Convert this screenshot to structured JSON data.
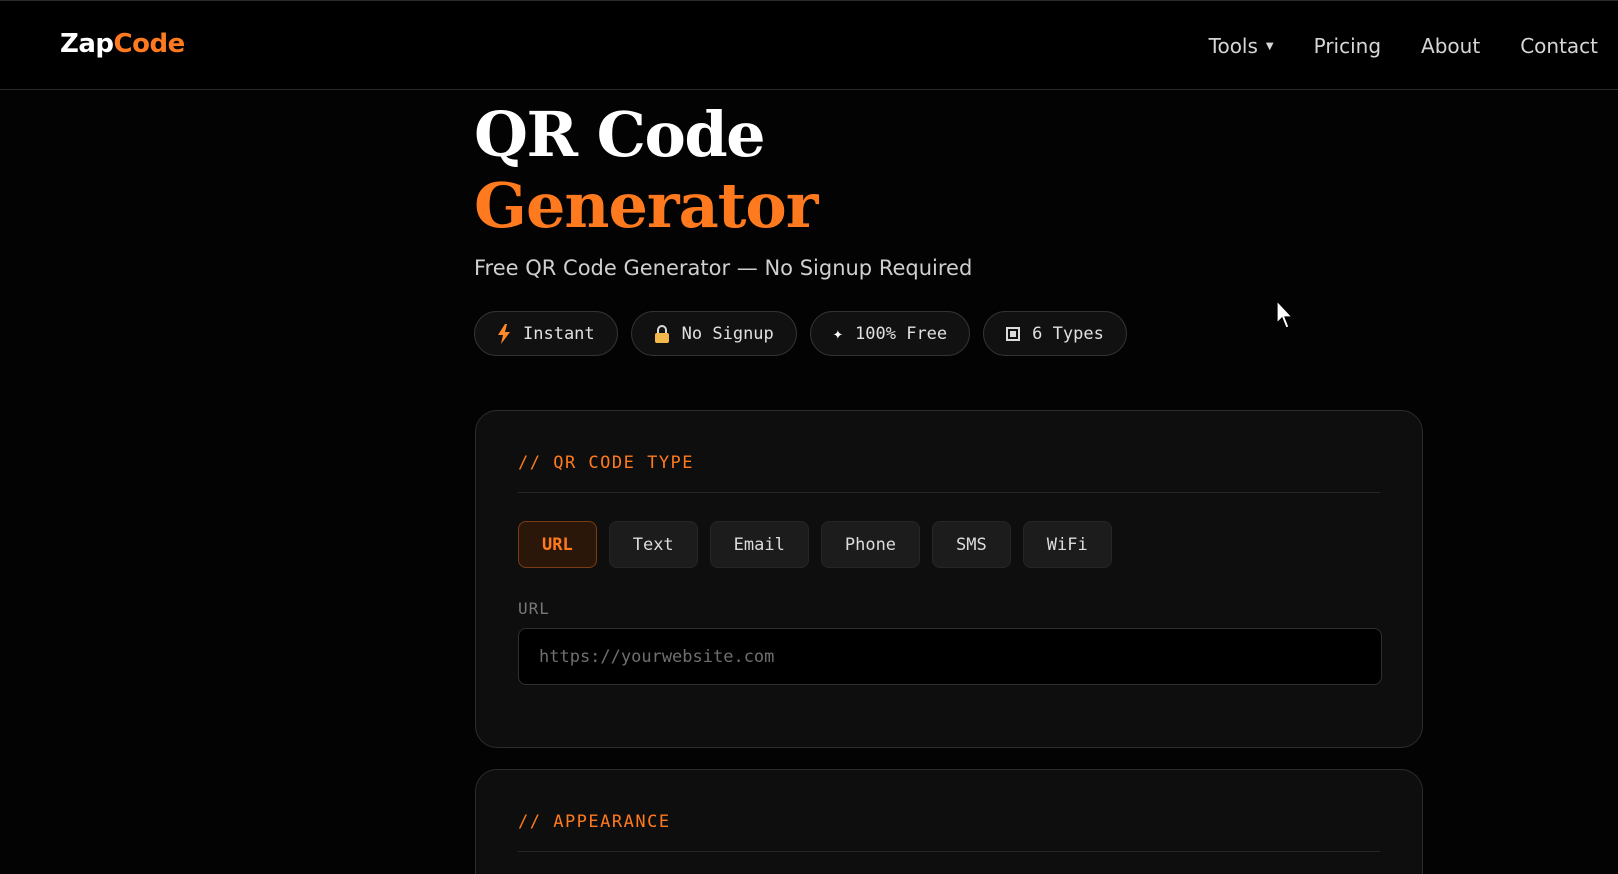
{
  "brand": {
    "part1": "Zap",
    "part2": "Code",
    "accent": "#ff7a1f"
  },
  "nav": {
    "items": [
      {
        "label": "Tools",
        "has_dropdown": true
      },
      {
        "label": "Pricing"
      },
      {
        "label": "About"
      },
      {
        "label": "Contact"
      }
    ]
  },
  "hero": {
    "title_line1": "QR Code",
    "title_line2": "Generator",
    "subtitle": "Free QR Code Generator — No Signup Required"
  },
  "badges": [
    {
      "icon": "bolt-icon",
      "label": "Instant"
    },
    {
      "icon": "lock-icon",
      "label": "No Signup"
    },
    {
      "icon": "sparkle-icon",
      "label": "100% Free"
    },
    {
      "icon": "square-icon",
      "label": "6 Types"
    }
  ],
  "type_card": {
    "heading": "// QR CODE TYPE",
    "types": [
      "URL",
      "Text",
      "Email",
      "Phone",
      "SMS",
      "WiFi"
    ],
    "selected": "URL",
    "field_label": "URL",
    "field_placeholder": "https://yourwebsite.com",
    "field_value": ""
  },
  "appearance_card": {
    "heading": "// APPEARANCE"
  }
}
